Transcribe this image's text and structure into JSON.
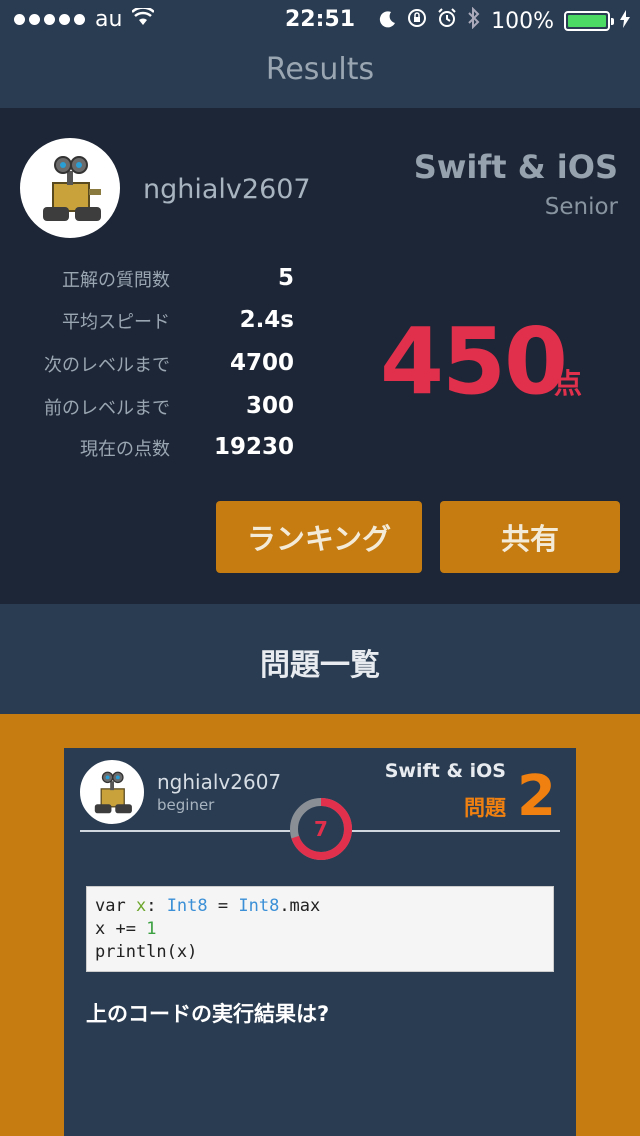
{
  "status_bar": {
    "carrier": "au",
    "time": "22:51",
    "battery": "100%"
  },
  "nav": {
    "title": "Results"
  },
  "profile": {
    "username": "nghialv2607",
    "course": "Swift & iOS",
    "level": "Senior",
    "stats": [
      {
        "label": "正解の質問数",
        "value": "5"
      },
      {
        "label": "平均スピード",
        "value": "2.4s"
      },
      {
        "label": "次のレベルまで",
        "value": "4700"
      },
      {
        "label": "前のレベルまで",
        "value": "300"
      },
      {
        "label": "現在の点数",
        "value": "19230"
      }
    ],
    "score": "450",
    "score_unit": "点",
    "ranking_button": "ランキング",
    "share_button": "共有"
  },
  "section": {
    "title": "問題一覧"
  },
  "question_card": {
    "username": "nghialv2607",
    "level": "beginer",
    "course": "Swift & iOS",
    "question_label": "問題",
    "question_number": "2",
    "timer": "7",
    "timer_progress": 0.7,
    "prompt": "上のコードの実行結果は?"
  },
  "colors": {
    "accent_orange": "#c67c10",
    "score_red": "#e0304c",
    "dark_navy": "#1d2636",
    "navy": "#2a3c51"
  }
}
